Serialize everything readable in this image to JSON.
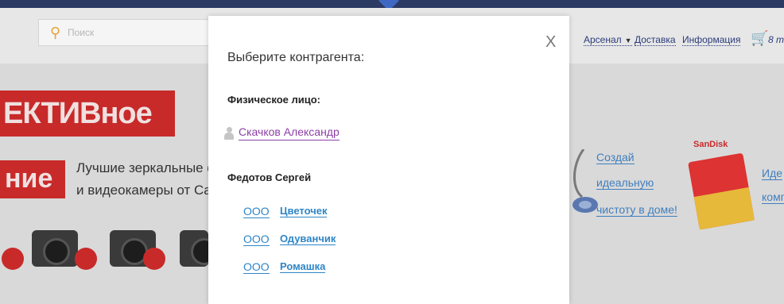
{
  "header": {
    "search_placeholder": "Поиск",
    "nav": [
      {
        "label": "Арсенал",
        "dropdown": true
      },
      {
        "label": "Доставка"
      },
      {
        "label": "Информация"
      }
    ],
    "cart_count": "8 m"
  },
  "background": {
    "banner_line1": "ЕКТИВное",
    "banner_line2": "ние",
    "promo_line1": "Лучшие зеркальные фо",
    "promo_line2": "и видеокамеры от Cano",
    "ad_links": [
      "Создай",
      "идеальную",
      "чистоту в доме!"
    ],
    "sandisk": "SanDisk",
    "right_links": [
      "Иде",
      "комп"
    ]
  },
  "modal": {
    "title": "Выберите контрагента:",
    "close_label": "X",
    "individual_heading": "Физическое лицо:",
    "individual_name": "Скачков Александр",
    "company_group_heading": "Федотов Сергей",
    "organizations": [
      {
        "type": "ООО",
        "name": "Цветочек"
      },
      {
        "type": "ООО",
        "name": "Одуванчик"
      },
      {
        "type": "ООО",
        "name": "Ромашка"
      }
    ]
  },
  "colors": {
    "accent_blue": "#2e86c8",
    "individual_link": "#8c3fa6",
    "banner_red": "#c82a2a",
    "frame": "#2b3a63"
  }
}
